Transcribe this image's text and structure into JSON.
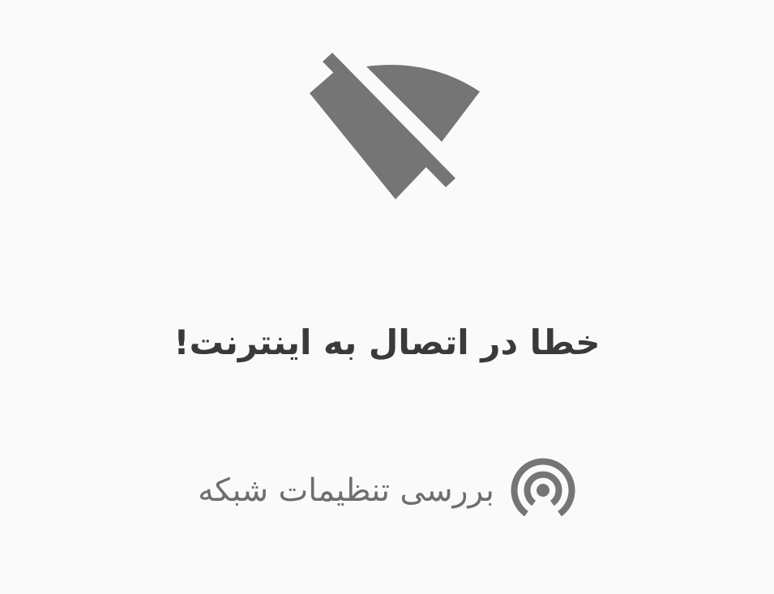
{
  "error": {
    "icon": "wifi-off-icon",
    "title": "خطا در اتصال به اینترنت!"
  },
  "action": {
    "icon": "network-signal-icon",
    "label": "بررسی تنظیمات شبکه"
  },
  "colors": {
    "background": "#fafafa",
    "icon": "#757575",
    "title": "#3a3a3a",
    "label": "#6e6e6e"
  }
}
